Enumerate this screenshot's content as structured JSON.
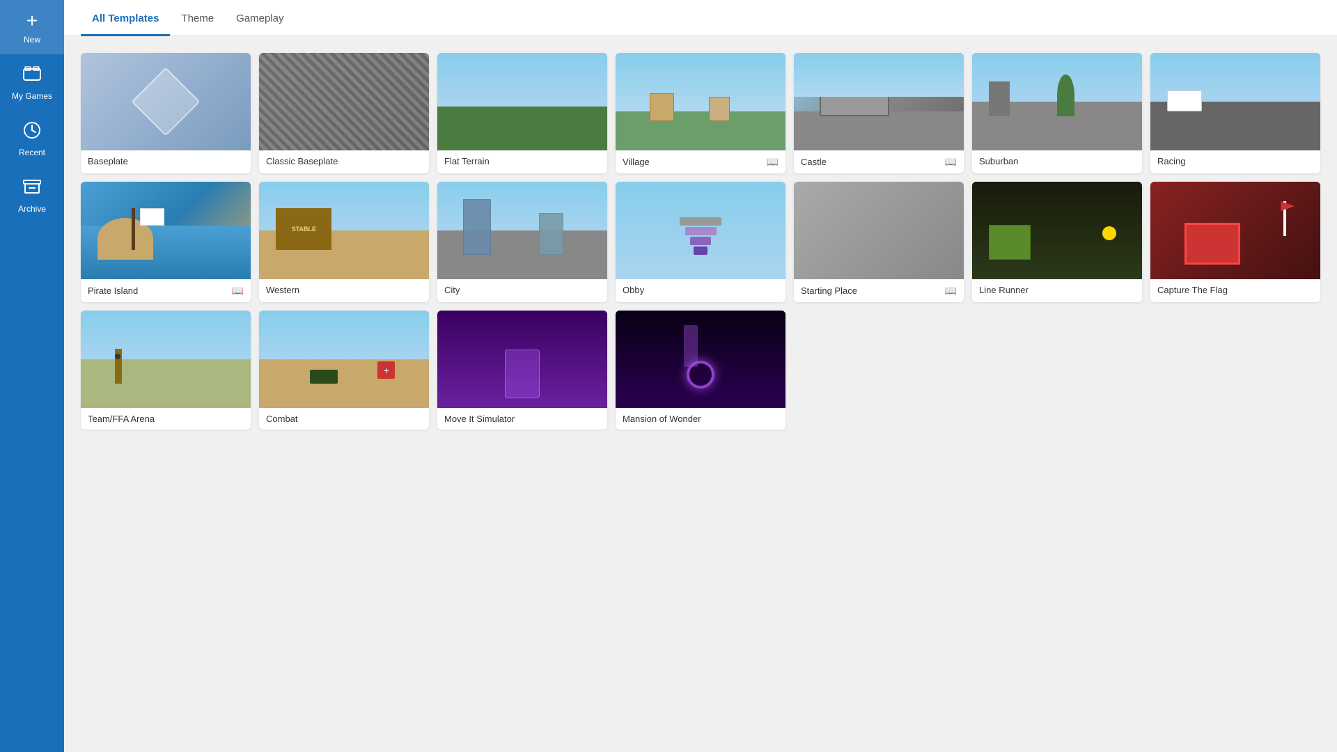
{
  "sidebar": {
    "new_label": "New",
    "my_games_label": "My Games",
    "recent_label": "Recent",
    "archive_label": "Archive"
  },
  "tabs": [
    {
      "id": "all",
      "label": "All Templates",
      "active": true
    },
    {
      "id": "theme",
      "label": "Theme",
      "active": false
    },
    {
      "id": "gameplay",
      "label": "Gameplay",
      "active": false
    }
  ],
  "templates": [
    {
      "id": "baseplate",
      "label": "Baseplate",
      "thumb_class": "thumb-baseplate",
      "has_book": false
    },
    {
      "id": "classic-baseplate",
      "label": "Classic Baseplate",
      "thumb_class": "thumb-classic",
      "has_book": false
    },
    {
      "id": "flat-terrain",
      "label": "Flat Terrain",
      "thumb_class": "thumb-flat",
      "has_book": false
    },
    {
      "id": "village",
      "label": "Village",
      "thumb_class": "thumb-village",
      "has_book": true
    },
    {
      "id": "castle",
      "label": "Castle",
      "thumb_class": "thumb-castle",
      "has_book": true
    },
    {
      "id": "suburban",
      "label": "Suburban",
      "thumb_class": "thumb-suburban",
      "has_book": false
    },
    {
      "id": "racing",
      "label": "Racing",
      "thumb_class": "thumb-racing",
      "has_book": false
    },
    {
      "id": "pirate-island",
      "label": "Pirate Island",
      "thumb_class": "thumb-pirate",
      "has_book": true
    },
    {
      "id": "western",
      "label": "Western",
      "thumb_class": "thumb-western",
      "has_book": false
    },
    {
      "id": "city",
      "label": "City",
      "thumb_class": "thumb-city",
      "has_book": false
    },
    {
      "id": "obby",
      "label": "Obby",
      "thumb_class": "thumb-obby",
      "has_book": false
    },
    {
      "id": "starting-place",
      "label": "Starting Place",
      "thumb_class": "thumb-starting",
      "has_book": true
    },
    {
      "id": "line-runner",
      "label": "Line Runner",
      "thumb_class": "thumb-linerunner",
      "has_book": false
    },
    {
      "id": "capture-the-flag",
      "label": "Capture The Flag",
      "thumb_class": "thumb-ctf",
      "has_book": false
    },
    {
      "id": "team-ffa-arena",
      "label": "Team/FFA Arena",
      "thumb_class": "thumb-team",
      "has_book": false
    },
    {
      "id": "combat",
      "label": "Combat",
      "thumb_class": "thumb-combat",
      "has_book": false
    },
    {
      "id": "move-it-simulator",
      "label": "Move It Simulator",
      "thumb_class": "thumb-moveit",
      "has_book": false
    },
    {
      "id": "mansion-of-wonder",
      "label": "Mansion of Wonder",
      "thumb_class": "thumb-mansion",
      "has_book": false
    }
  ],
  "book_icon": "📖",
  "icons": {
    "new": "+",
    "my_games": "🎮",
    "recent": "🕐",
    "archive": "🗄"
  }
}
